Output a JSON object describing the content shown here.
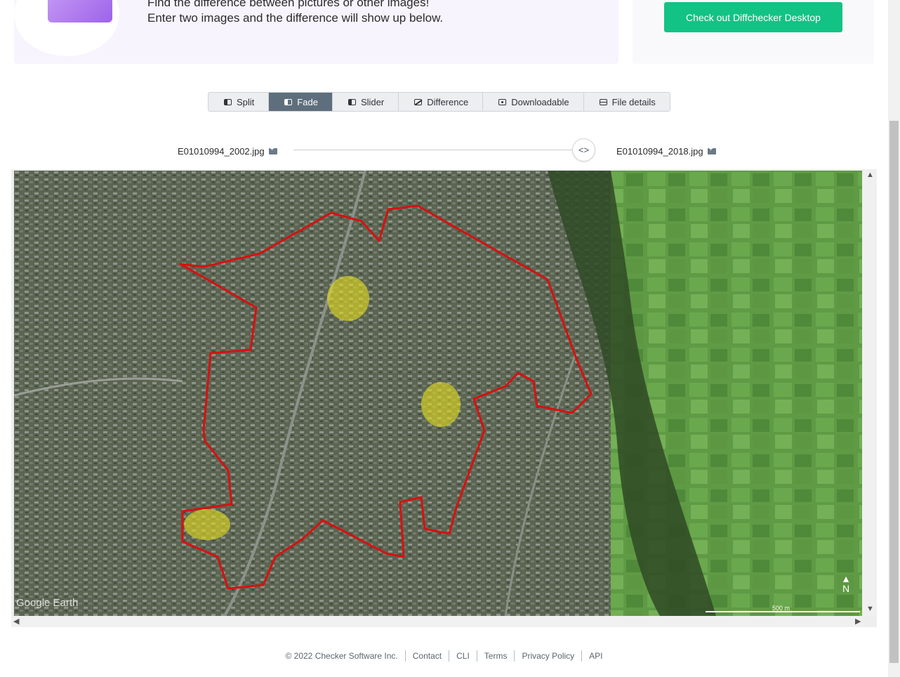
{
  "hero": {
    "line1": "Find the difference between pictures or other images!",
    "line2": "Enter two images and the difference will show up below."
  },
  "side": {
    "desktop_button": "Check out Diffchecker Desktop"
  },
  "tabs": [
    {
      "label": "Split",
      "icon": "split-icon"
    },
    {
      "label": "Fade",
      "icon": "fade-icon",
      "active": true
    },
    {
      "label": "Slider",
      "icon": "slider-icon"
    },
    {
      "label": "Difference",
      "icon": "difference-icon"
    },
    {
      "label": "Downloadable",
      "icon": "download-icon"
    },
    {
      "label": "File details",
      "icon": "file-details-icon"
    }
  ],
  "compare": {
    "left_file": "E01010994_2002.jpg",
    "right_file": "E01010994_2018.jpg",
    "handle_glyph": "<>"
  },
  "map": {
    "watermark": "Google Earth",
    "scale_label": "500 m",
    "north_label": "N"
  },
  "colors": {
    "accent_green": "#12c385",
    "tab_active": "#5e6e7c",
    "boundary_red": "#d91010",
    "highlight_yellow": "#e6e01e"
  },
  "footer": {
    "copyright": "© 2022 Checker Software Inc.",
    "links": [
      "Contact",
      "CLI",
      "Terms",
      "Privacy Policy",
      "API"
    ]
  }
}
